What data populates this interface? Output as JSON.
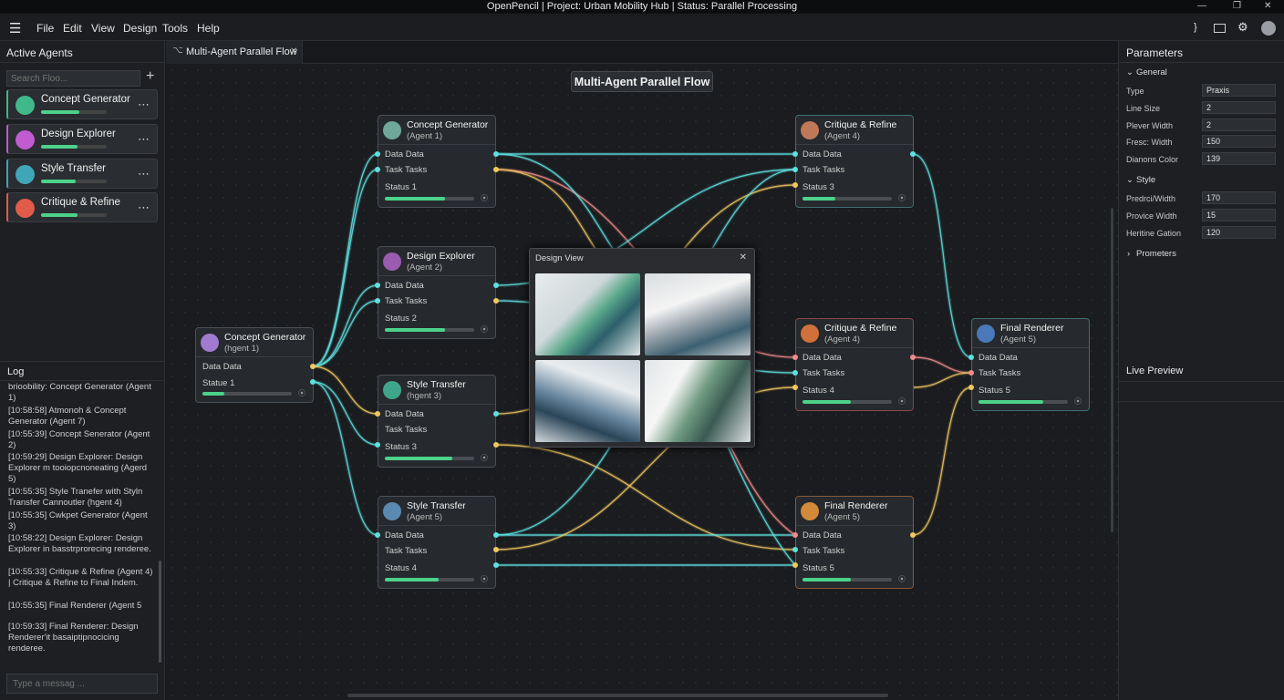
{
  "window": {
    "title": "OpenPencil | Project: Urban Mobility Hub | Status: Parallel Processing"
  },
  "menu": [
    "File",
    "Edit",
    "View",
    "Design",
    "Tools",
    "Help"
  ],
  "left_panel": {
    "title": "Active Agents",
    "search_placeholder": "Search Floo...",
    "agents": [
      {
        "name": "Concept Generator",
        "progress": 0.58,
        "color": "#3fb88a"
      },
      {
        "name": "Design Explorer",
        "progress": 0.55,
        "color": "#c05bd0"
      },
      {
        "name": "Style Transfer",
        "progress": 0.53,
        "color": "#3fa6b8"
      },
      {
        "name": "Critique & Refine",
        "progress": 0.55,
        "color": "#e05b4a"
      }
    ]
  },
  "log": {
    "title": "Log",
    "lines": [
      "brioobility: Concept Generator (Agent 1)",
      "[10:58:58] Atmonoh & Concept Generator (Agent 7)",
      "[10:55:39] Concept Senerator (Agent 2)",
      "[10:59:29] Design Explorer: Design Explorer m tooiopcnoneating (Agerd 5)",
      "[10:55:35] Style Tranefer with Styln Transfer Cannoutler (hgent 4)",
      "[10:55:35] Cwkpet Generator (Agent 3)",
      "[10:58:22] Design Explorer: Design Explorer in basstrprorecing renderee.",
      "[10:55:33] Critique & Refine (Agent 4) | Critique & Refine to Final Indem.",
      "[10:55:35] Final Renderer (Agent 5",
      "[10:59:33] Final Renderer: Design Renderer'it basaiptipnocicing renderee."
    ],
    "input_placeholder": "Type a messag ..."
  },
  "tab": {
    "label": "Multi-Agent Parallel Flow"
  },
  "canvas": {
    "title": "Multi-Agent Parallel Flow"
  },
  "nodes": [
    {
      "name": "Concept Generator",
      "sub": "(hgent 1)",
      "rows": [
        "Data Data"
      ],
      "status": "Statue 1",
      "progress": 0.24,
      "avatar": "#a07bd0"
    },
    {
      "name": "Concept Generator",
      "sub": "(Agent 1)",
      "rows": [
        "Data Data",
        "Task Tasks"
      ],
      "status": "Status 1",
      "progress": 0.67,
      "avatar": "#6fa89a"
    },
    {
      "name": "Design Explorer",
      "sub": "(Agent 2)",
      "rows": [
        "Data Data",
        "Task Tasks"
      ],
      "status": "Status 2",
      "progress": 0.67,
      "avatar": "#9a5bb0"
    },
    {
      "name": "Style Transfer",
      "sub": "(hgent 3)",
      "rows": [
        "Data Data",
        "Task Tasks"
      ],
      "status": "Status 3",
      "progress": 0.76,
      "avatar": "#3fa68a"
    },
    {
      "name": "Style Transfer",
      "sub": "(Agent 5)",
      "rows": [
        "Data Data",
        "Task Tasks"
      ],
      "status": "Status 4",
      "progress": 0.6,
      "avatar": "#5a8ab0"
    },
    {
      "name": "Critique & Refine",
      "sub": "(Agent 4)",
      "rows": [
        "Data Data",
        "Task Tasks"
      ],
      "status": "Status 3",
      "progress": 0.37,
      "avatar": "#c07858"
    },
    {
      "name": "Critique & Refine",
      "sub": "(Agent 4)",
      "rows": [
        "Data Data",
        "Task Tasks"
      ],
      "status": "Status 4",
      "progress": 0.54,
      "avatar": "#d0703a"
    },
    {
      "name": "Final Renderer",
      "sub": "(Agent 5)",
      "rows": [
        "Data Data",
        "Task Tasks"
      ],
      "status": "Status 5",
      "progress": 0.54,
      "avatar": "#d08a3a"
    },
    {
      "name": "Final Renderer",
      "sub": "(Agent 5)",
      "rows": [
        "Data Data",
        "Task Tasks"
      ],
      "status": "Status 5",
      "progress": 0.72,
      "avatar": "#4a78b8"
    }
  ],
  "design_view": {
    "title": "Design View"
  },
  "parameters": {
    "title": "Parameters",
    "general": {
      "label": "General",
      "rows": [
        {
          "k": "Type",
          "v": "Praxis"
        },
        {
          "k": "Line Size",
          "v": "2"
        },
        {
          "k": "Plever Width",
          "v": "2"
        },
        {
          "k": "Fresc: Width",
          "v": "150"
        },
        {
          "k": "Dianons Color",
          "v": "139"
        }
      ]
    },
    "style": {
      "label": "Style",
      "rows": [
        {
          "k": "Predrci/Width",
          "v": "170"
        },
        {
          "k": "Provice Width",
          "v": "15"
        },
        {
          "k": "Heritine Gation",
          "v": "120"
        }
      ]
    },
    "prometers": {
      "label": "Prometers"
    }
  },
  "live_preview": {
    "title": "Live Preview"
  },
  "colors": {
    "accent": "#4cd28a",
    "wire_cyan": "#5fe0e0",
    "wire_yellow": "#f0c860",
    "wire_pink": "#ef8c8c"
  }
}
